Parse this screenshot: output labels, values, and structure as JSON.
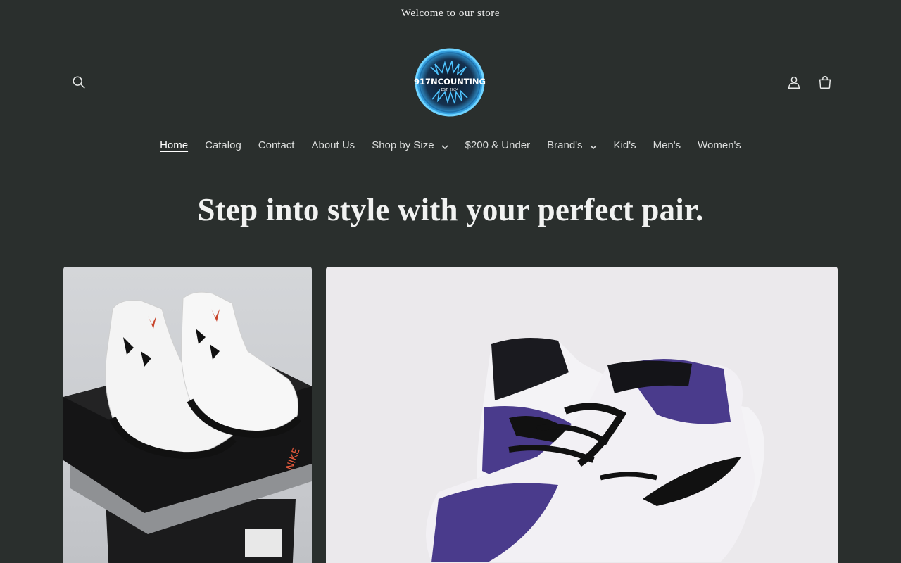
{
  "announcement": {
    "text": "Welcome to our store"
  },
  "header": {
    "logo": {
      "text": "917NCOUNTING",
      "subtext": "EST. 2024"
    },
    "icons": {
      "search": "search-icon",
      "account": "user-icon",
      "cart": "bag-icon"
    }
  },
  "nav": {
    "items": [
      {
        "label": "Home",
        "active": true,
        "dropdown": false
      },
      {
        "label": "Catalog",
        "dropdown": false
      },
      {
        "label": "Contact",
        "dropdown": false
      },
      {
        "label": "About Us",
        "dropdown": false
      },
      {
        "label": "Shop by Size",
        "dropdown": true
      },
      {
        "label": "$200 & Under",
        "dropdown": false
      },
      {
        "label": "Brand's",
        "dropdown": true
      },
      {
        "label": "Kid's",
        "dropdown": false
      },
      {
        "label": "Men's",
        "dropdown": false
      },
      {
        "label": "Women's",
        "dropdown": false
      }
    ]
  },
  "hero": {
    "headline": "Step into style with your perfect pair."
  },
  "colors": {
    "background": "#2a2f2d",
    "text": "#e9ebea",
    "accent_purple": "#4a3b8c"
  }
}
